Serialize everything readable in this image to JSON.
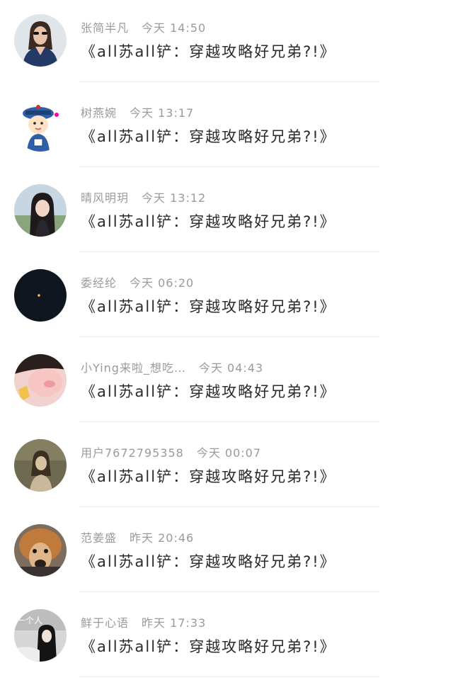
{
  "comments": [
    {
      "user": "张简半凡",
      "time": "今天 14:50",
      "text": "《all苏all铲：穿越攻略好兄弟?!》",
      "avatar_icon": "woman-sunglasses-avatar"
    },
    {
      "user": "树燕婉",
      "time": "今天 13:17",
      "text": "《all苏all铲：穿越攻略好兄弟?!》",
      "avatar_icon": "cartoon-qing-official-avatar"
    },
    {
      "user": "晴风明玥",
      "time": "今天 13:12",
      "text": "《all苏all铲：穿越攻略好兄弟?!》",
      "avatar_icon": "girl-portrait-avatar"
    },
    {
      "user": "委经纶",
      "time": "今天 06:20",
      "text": "《all苏all铲：穿越攻略好兄弟?!》",
      "avatar_icon": "night-sky-avatar"
    },
    {
      "user": "小Ying来啦_想吃…",
      "time": "今天 04:43",
      "text": "《all苏all铲：穿越攻略好兄弟?!》",
      "avatar_icon": "blurred-face-avatar"
    },
    {
      "user": "用户7672795358",
      "time": "今天 00:07",
      "text": "《all苏all铲：穿越攻略好兄弟?!》",
      "avatar_icon": "vintage-girl-avatar"
    },
    {
      "user": "范姜盛",
      "time": "昨天 20:46",
      "text": "《all苏all铲：穿越攻略好兄弟?!》",
      "avatar_icon": "alpaca-avatar"
    },
    {
      "user": "鲜于心语",
      "time": "昨天 17:33",
      "text": "《all苏all铲：穿越攻略好兄弟?!》",
      "avatar_icon": "one-person-avatar",
      "avatar_text": "一个人"
    }
  ]
}
